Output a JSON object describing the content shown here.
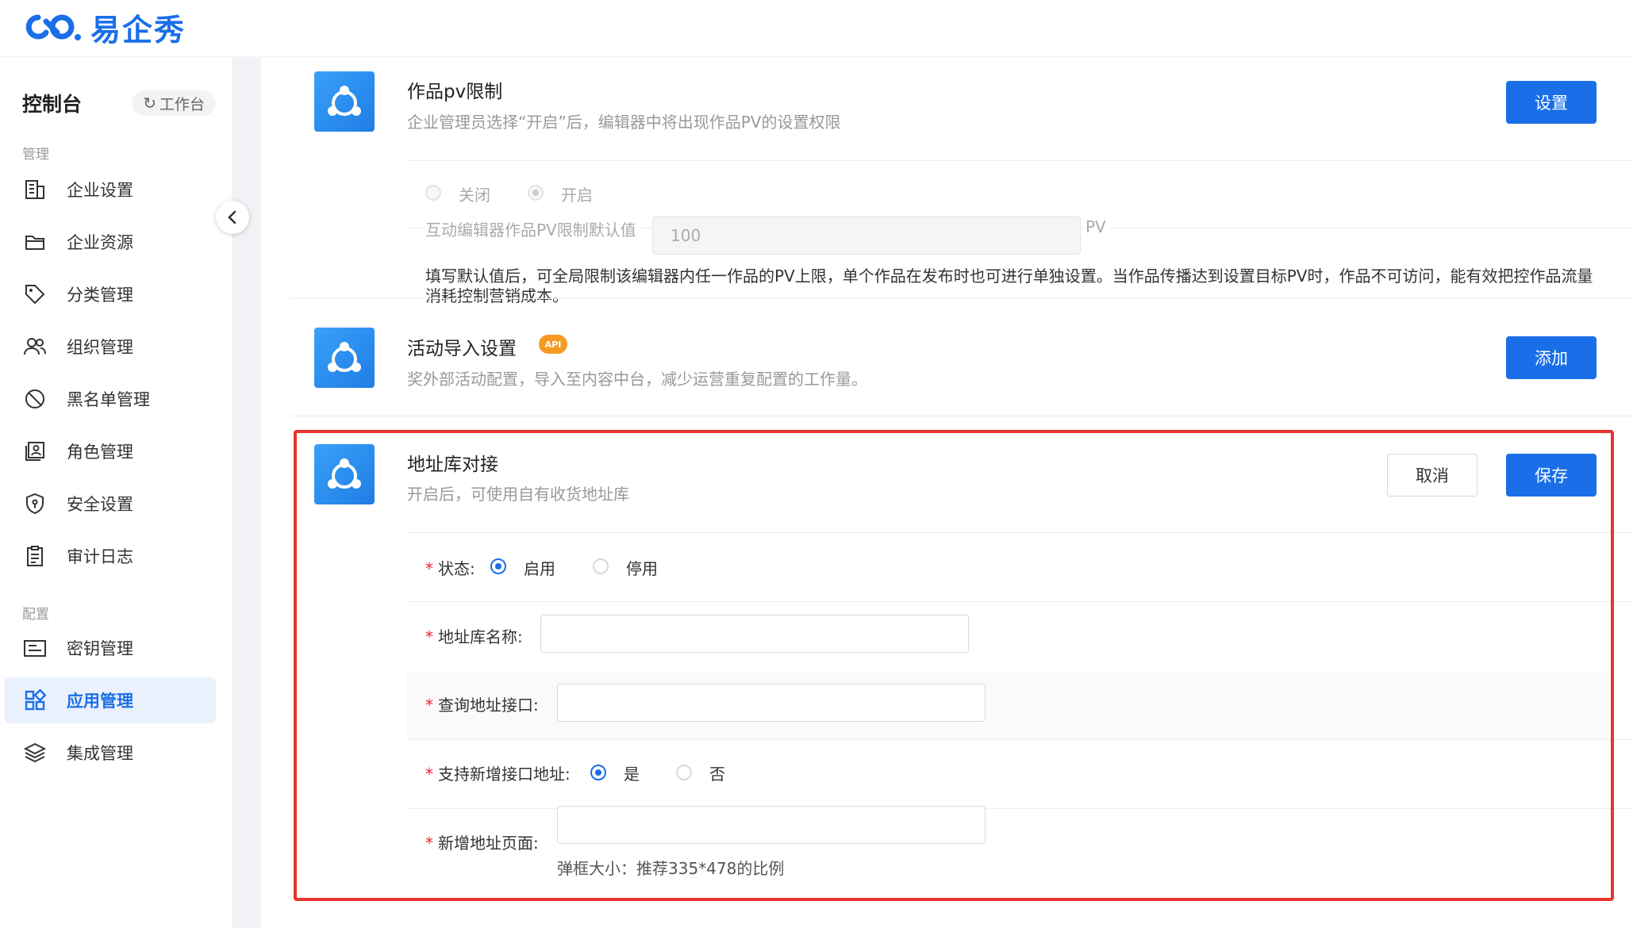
{
  "brand": {
    "name": "易企秀"
  },
  "sidebar": {
    "title": "控制台",
    "workbench_label": "工作台",
    "groups": [
      "管理",
      "配置"
    ],
    "items": [
      {
        "label": "企业设置",
        "icon": "building-icon"
      },
      {
        "label": "企业资源",
        "icon": "folder-icon"
      },
      {
        "label": "分类管理",
        "icon": "tag-icon"
      },
      {
        "label": "组织管理",
        "icon": "users-icon"
      },
      {
        "label": "黑名单管理",
        "icon": "ban-icon"
      },
      {
        "label": "角色管理",
        "icon": "role-icon"
      },
      {
        "label": "安全设置",
        "icon": "shield-icon"
      },
      {
        "label": "审计日志",
        "icon": "clipboard-icon"
      },
      {
        "label": "密钥管理",
        "icon": "key-card-icon"
      },
      {
        "label": "应用管理",
        "icon": "apps-icon",
        "active": true
      },
      {
        "label": "集成管理",
        "icon": "layers-icon"
      }
    ]
  },
  "cards": {
    "pv": {
      "title": "作品pv限制",
      "desc": "企业管理员选择“开启”后，编辑器中将出现作品PV的设置权限",
      "button": "设置",
      "radio_off": "关闭",
      "radio_on": "开启",
      "default_label": "互动编辑器作品PV限制默认值",
      "default_value": "100",
      "unit": "PV",
      "note": "填写默认值后，可全局限制该编辑器内任一作品的PV上限，单个作品在发布时也可进行单独设置。当作品传播达到设置目标PV时，作品不可访问，能有效把控作品流量消耗控制营销成本。"
    },
    "activity": {
      "title": "活动导入设置",
      "badge": "API",
      "desc": "奖外部活动配置，导入至内容中台，减少运营重复配置的工作量。",
      "button": "添加"
    },
    "address": {
      "title": "地址库对接",
      "desc": "开启后，可使用自有收货地址库",
      "cancel": "取消",
      "save": "保存",
      "required_mark": "*",
      "status_label": "状态:",
      "status_enable": "启用",
      "status_disable": "停用",
      "name_label": "地址库名称:",
      "query_label": "查询地址接口:",
      "support_label": "支持新增接口地址:",
      "yes": "是",
      "no": "否",
      "new_page_label": "新增地址页面:",
      "hint": "弹框大小：推荐335*478的比例"
    }
  }
}
